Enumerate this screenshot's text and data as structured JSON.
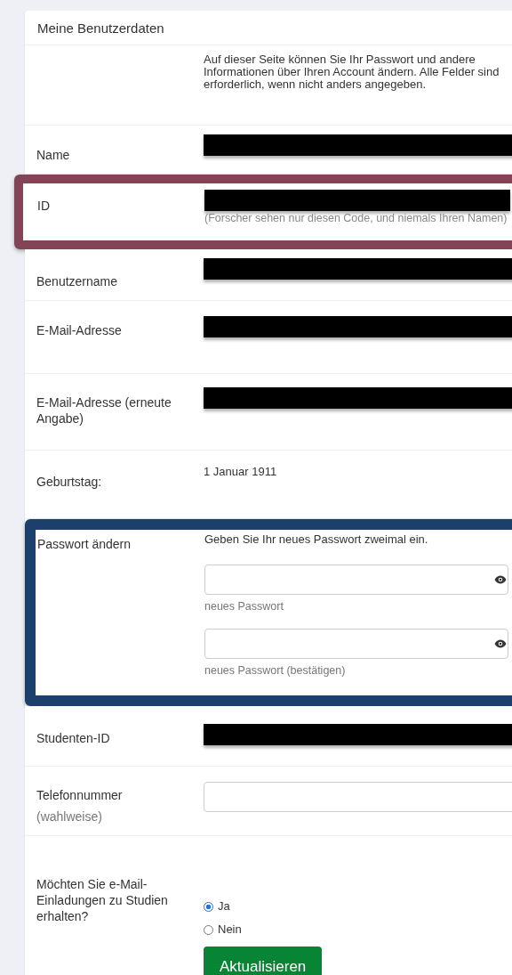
{
  "title": "Meine Benutzerdaten",
  "rows": [
    {
      "kind": "intro",
      "text": "Auf dieser Seite können Sie Ihr Passwort und andere Informationen über Ihren Account ändern. Alle Felder sind erforderlich, wenn nicht anders angegeben."
    },
    {
      "kind": "redacted",
      "label": "Name"
    },
    {
      "kind": "redacted",
      "label": "ID",
      "help": "(Forscher sehen nur diesen Code, und niemals Ihren Namen)",
      "color": "#844457"
    },
    {
      "kind": "redacted",
      "label": "Benutzername"
    },
    {
      "kind": "redacted",
      "label": "E-Mail-Adresse"
    },
    {
      "kind": "redacted",
      "label": "E-Mail-Adresse (erneute Angabe)"
    },
    {
      "kind": "text",
      "label": "Geburtstag:",
      "value": "1 Januar 1911"
    },
    {
      "kind": "password",
      "label": "Passwort ändern",
      "text": "Geben Sie Ihr neues Passwort zweimal ein.",
      "fields": [
        {
          "help": "neues Passwort"
        },
        {
          "help": "neues Passwort (bestätigen)"
        }
      ],
      "color": "#1c3f6b"
    },
    {
      "kind": "redacted",
      "label": "Studenten-ID"
    },
    {
      "kind": "input",
      "label": "Telefonnummer",
      "note": "(wahlweise)"
    },
    {
      "kind": "radio",
      "label": "Möchten Sie e-Mail-Einladungen zu Studien erhalten?",
      "options": [
        {
          "label": "Ja",
          "selected": true
        },
        {
          "label": "Nein",
          "selected": false
        }
      ],
      "button": "Aktualisieren"
    }
  ]
}
